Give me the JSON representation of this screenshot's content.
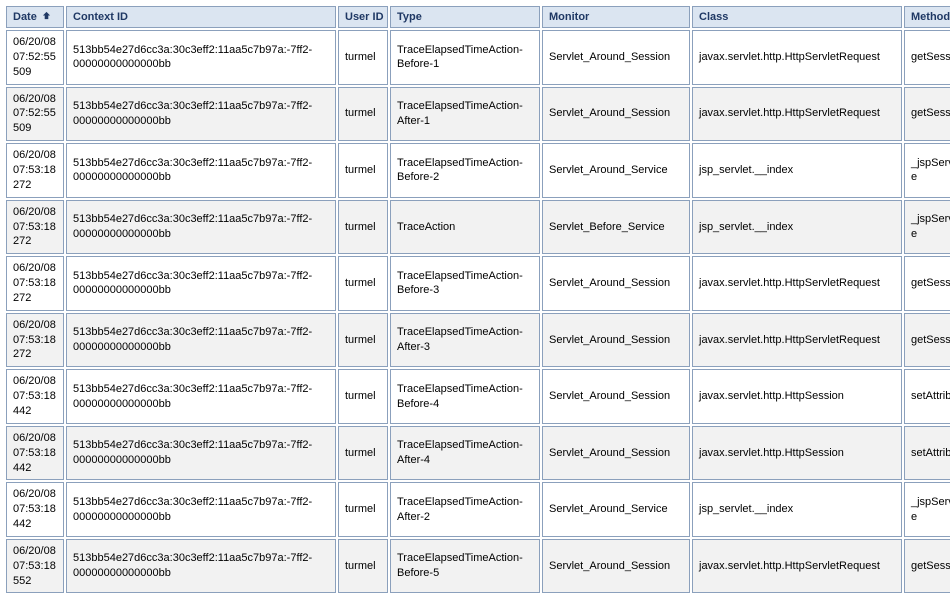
{
  "columns": {
    "date": {
      "label": "Date",
      "sorted": true
    },
    "context": {
      "label": "Context ID",
      "sorted": false
    },
    "user": {
      "label": "User ID",
      "sorted": false
    },
    "type": {
      "label": "Type",
      "sorted": false
    },
    "monitor": {
      "label": "Monitor",
      "sorted": false
    },
    "class": {
      "label": "Class",
      "sorted": false
    },
    "method": {
      "label": "Method",
      "sorted": false
    }
  },
  "rows": [
    {
      "date": "06/20/08 07:52:55 509",
      "context": "513bb54e27d6cc3a:30c3eff2:11aa5c7b97a:-7ff2-00000000000000bb",
      "user": "turmel",
      "type": "TraceElapsedTimeAction-Before-1",
      "monitor": "Servlet_Around_Session",
      "class": "javax.servlet.http.HttpServletRequest",
      "method": "getSession"
    },
    {
      "date": "06/20/08 07:52:55 509",
      "context": "513bb54e27d6cc3a:30c3eff2:11aa5c7b97a:-7ff2-00000000000000bb",
      "user": "turmel",
      "type": "TraceElapsedTimeAction-After-1",
      "monitor": "Servlet_Around_Session",
      "class": "javax.servlet.http.HttpServletRequest",
      "method": "getSession"
    },
    {
      "date": "06/20/08 07:53:18 272",
      "context": "513bb54e27d6cc3a:30c3eff2:11aa5c7b97a:-7ff2-00000000000000bb",
      "user": "turmel",
      "type": "TraceElapsedTimeAction-Before-2",
      "monitor": "Servlet_Around_Service",
      "class": "jsp_servlet.__index",
      "method": "_jspService"
    },
    {
      "date": "06/20/08 07:53:18 272",
      "context": "513bb54e27d6cc3a:30c3eff2:11aa5c7b97a:-7ff2-00000000000000bb",
      "user": "turmel",
      "type": "TraceAction",
      "monitor": "Servlet_Before_Service",
      "class": "jsp_servlet.__index",
      "method": "_jspService"
    },
    {
      "date": "06/20/08 07:53:18 272",
      "context": "513bb54e27d6cc3a:30c3eff2:11aa5c7b97a:-7ff2-00000000000000bb",
      "user": "turmel",
      "type": "TraceElapsedTimeAction-Before-3",
      "monitor": "Servlet_Around_Session",
      "class": "javax.servlet.http.HttpServletRequest",
      "method": "getSession"
    },
    {
      "date": "06/20/08 07:53:18 272",
      "context": "513bb54e27d6cc3a:30c3eff2:11aa5c7b97a:-7ff2-00000000000000bb",
      "user": "turmel",
      "type": "TraceElapsedTimeAction-After-3",
      "monitor": "Servlet_Around_Session",
      "class": "javax.servlet.http.HttpServletRequest",
      "method": "getSession"
    },
    {
      "date": "06/20/08 07:53:18 442",
      "context": "513bb54e27d6cc3a:30c3eff2:11aa5c7b97a:-7ff2-00000000000000bb",
      "user": "turmel",
      "type": "TraceElapsedTimeAction-Before-4",
      "monitor": "Servlet_Around_Session",
      "class": "javax.servlet.http.HttpSession",
      "method": "setAttribute"
    },
    {
      "date": "06/20/08 07:53:18 442",
      "context": "513bb54e27d6cc3a:30c3eff2:11aa5c7b97a:-7ff2-00000000000000bb",
      "user": "turmel",
      "type": "TraceElapsedTimeAction-After-4",
      "monitor": "Servlet_Around_Session",
      "class": "javax.servlet.http.HttpSession",
      "method": "setAttribute"
    },
    {
      "date": "06/20/08 07:53:18 442",
      "context": "513bb54e27d6cc3a:30c3eff2:11aa5c7b97a:-7ff2-00000000000000bb",
      "user": "turmel",
      "type": "TraceElapsedTimeAction-After-2",
      "monitor": "Servlet_Around_Service",
      "class": "jsp_servlet.__index",
      "method": "_jspService"
    },
    {
      "date": "06/20/08 07:53:18 552",
      "context": "513bb54e27d6cc3a:30c3eff2:11aa5c7b97a:-7ff2-00000000000000bb",
      "user": "turmel",
      "type": "TraceElapsedTimeAction-Before-5",
      "monitor": "Servlet_Around_Session",
      "class": "javax.servlet.http.HttpServletRequest",
      "method": "getSession"
    }
  ]
}
